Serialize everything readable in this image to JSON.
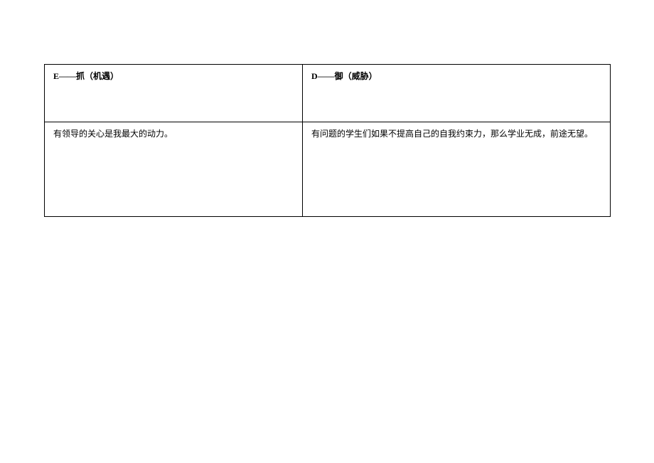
{
  "table": {
    "header": {
      "left": "E——抓（机遇）",
      "right": "D——御（威胁）"
    },
    "body": {
      "left": "有领导的关心是我最大的动力。",
      "right": "有问题的学生们如果不提高自己的自我约束力，那么学业无成，前途无望。"
    }
  }
}
